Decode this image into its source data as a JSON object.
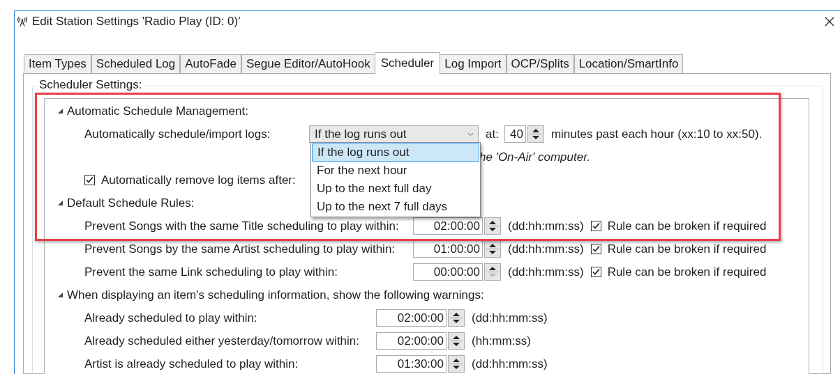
{
  "window": {
    "title": "Edit Station Settings 'Radio Play (ID: 0)'"
  },
  "tabs": [
    {
      "label": "Item Types",
      "selected": false
    },
    {
      "label": "Scheduled Log",
      "selected": false
    },
    {
      "label": "AutoFade",
      "selected": false
    },
    {
      "label": "Segue Editor/AutoHook",
      "selected": false
    },
    {
      "label": "Scheduler",
      "selected": true
    },
    {
      "label": "Log Import",
      "selected": false
    },
    {
      "label": "OCP/Splits",
      "selected": false
    },
    {
      "label": "Location/SmartInfo",
      "selected": false
    }
  ],
  "group": {
    "title": "Scheduler Settings:"
  },
  "sections": [
    {
      "heading": "Automatic Schedule Management:",
      "expanded": true,
      "rows": [
        {
          "kind": "combo",
          "label": "Automatically schedule/import logs:",
          "value": "If the log runs out",
          "at_label": "at:",
          "minutes": "40",
          "suffix": "minutes past each hour (xx:10 to xx:50)."
        },
        {
          "kind": "hint",
          "text": "he 'On-Air' computer."
        },
        {
          "kind": "check",
          "label": "Automatically remove log items after:",
          "checked": true
        }
      ]
    },
    {
      "heading": "Default Schedule Rules:",
      "expanded": true,
      "rows": [
        {
          "kind": "rule",
          "label": "Prevent Songs with the same Title scheduling to play within:",
          "value": "02:00:00",
          "down_disabled": false,
          "unit": "(dd:hh:mm:ss)",
          "check_label": "Rule can be broken if required",
          "checked": true
        },
        {
          "kind": "rule",
          "label": "Prevent Songs by the same Artist scheduling to play within:",
          "value": "01:00:00",
          "down_disabled": false,
          "unit": "(dd:hh:mm:ss)",
          "check_label": "Rule can be broken if required",
          "checked": true
        },
        {
          "kind": "rule",
          "label": "Prevent the same Link scheduling to play within:",
          "value": "00:00:00",
          "down_disabled": true,
          "unit": "(dd:hh:mm:ss)",
          "check_label": "Rule can be broken if required",
          "checked": true
        }
      ]
    },
    {
      "heading": "When displaying an item's scheduling information, show the following warnings:",
      "expanded": true,
      "rows": [
        {
          "kind": "warning",
          "label": "Already scheduled to play within:",
          "value": "02:00:00",
          "down_disabled": false,
          "unit": "(dd:hh:mm:ss)"
        },
        {
          "kind": "warning",
          "label": "Already scheduled either yesterday/tomorrow within:",
          "value": "02:00:00",
          "down_disabled": false,
          "unit": "(hh:mm:ss)"
        },
        {
          "kind": "warning",
          "label": "Artist is already scheduled to play within:",
          "value": "01:30:00",
          "down_disabled": false,
          "unit": "(dd:hh:mm:ss)"
        }
      ]
    }
  ],
  "dropdown": {
    "items": [
      {
        "label": "If the log runs out",
        "selected": true
      },
      {
        "label": "For the next hour",
        "selected": false
      },
      {
        "label": "Up to the next full day",
        "selected": false
      },
      {
        "label": "Up to the next 7 full days",
        "selected": false
      }
    ]
  }
}
